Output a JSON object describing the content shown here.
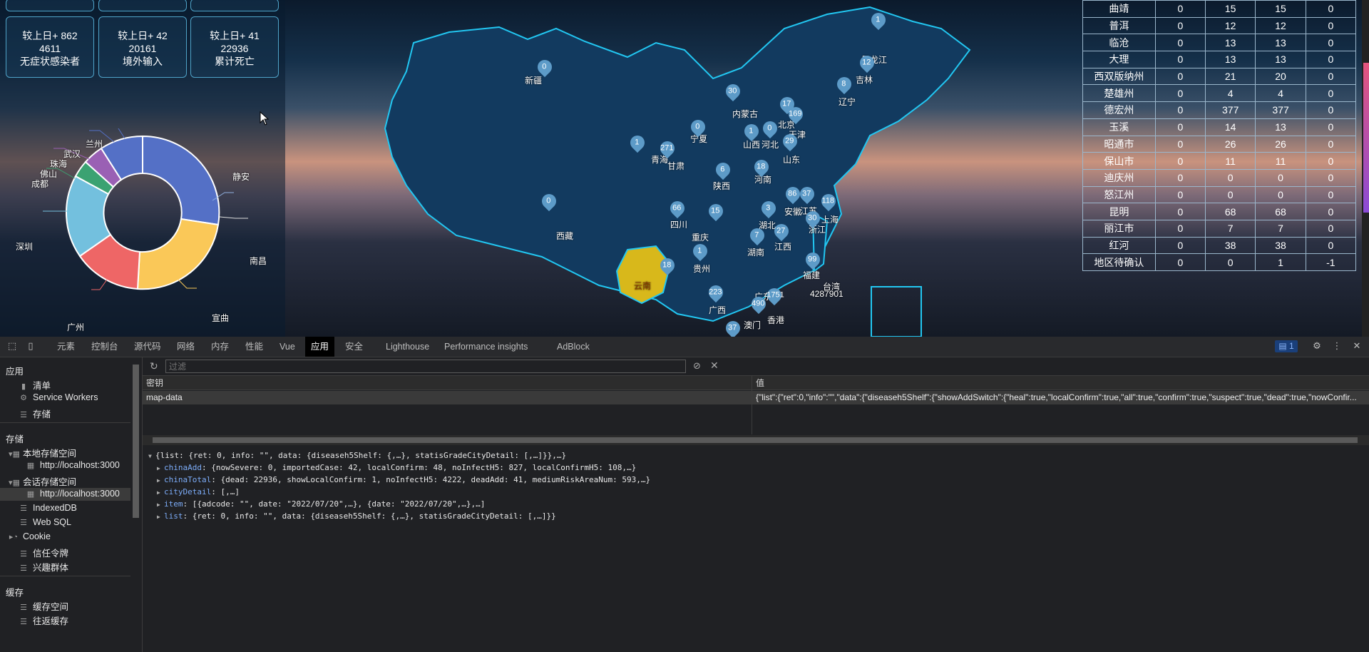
{
  "stats": {
    "cards": [
      {
        "line1": "较上日+ 862",
        "line2": "4611",
        "line3": "无症状感染者"
      },
      {
        "line1": "较上日+ 42",
        "line2": "20161",
        "line3": "境外输入"
      },
      {
        "line1": "较上日+ 41",
        "line2": "22936",
        "line3": "累计死亡"
      }
    ]
  },
  "donut": {
    "labels": [
      "静安",
      "南昌",
      "宣曲",
      "广州",
      "深圳",
      "成都",
      "佛山",
      "珠海",
      "武汉",
      "兰州"
    ],
    "colors": {
      "blue": "#5470c6",
      "yellow": "#fac858",
      "red": "#ee6666",
      "cyan": "#73c0de",
      "green": "#3ba272",
      "purple": "#9a60b4"
    }
  },
  "map": {
    "provinces": [
      "新疆",
      "西藏",
      "青海",
      "甘肃",
      "宁夏",
      "内蒙古",
      "黑龙江",
      "吉林",
      "辽宁",
      "北京",
      "天津",
      "河北",
      "山西",
      "山东",
      "河南",
      "陕西",
      "四川",
      "重庆",
      "湖北",
      "安徽",
      "江苏",
      "上海",
      "浙江",
      "湖南",
      "江西",
      "福建",
      "贵州",
      "云南",
      "广西",
      "广东",
      "台湾",
      "香港",
      "澳门"
    ],
    "pins": [
      "0",
      "0",
      "1",
      "271",
      "0",
      "30",
      "1",
      "12",
      "8",
      "17",
      "169",
      "1",
      "0",
      "29",
      "18",
      "6",
      "66",
      "15",
      "3",
      "86",
      "37",
      "118",
      "30",
      "7",
      "27",
      "99",
      "1",
      "18",
      "223",
      "1751",
      "490",
      "37"
    ],
    "taiwan_value": "4287901",
    "highlight": "云南",
    "highlight_color": "#d8b81b"
  },
  "table": {
    "rows": [
      [
        "曲靖",
        "0",
        "15",
        "15",
        "0"
      ],
      [
        "普洱",
        "0",
        "12",
        "12",
        "0"
      ],
      [
        "临沧",
        "0",
        "13",
        "13",
        "0"
      ],
      [
        "大理",
        "0",
        "13",
        "13",
        "0"
      ],
      [
        "西双版纳州",
        "0",
        "21",
        "20",
        "0"
      ],
      [
        "楚雄州",
        "0",
        "4",
        "4",
        "0"
      ],
      [
        "德宏州",
        "0",
        "377",
        "377",
        "0"
      ],
      [
        "玉溪",
        "0",
        "14",
        "13",
        "0"
      ],
      [
        "昭通市",
        "0",
        "26",
        "26",
        "0"
      ],
      [
        "保山市",
        "0",
        "11",
        "11",
        "0"
      ],
      [
        "迪庆州",
        "0",
        "0",
        "0",
        "0"
      ],
      [
        "怒江州",
        "0",
        "0",
        "0",
        "0"
      ],
      [
        "昆明",
        "0",
        "68",
        "68",
        "0"
      ],
      [
        "丽江市",
        "0",
        "7",
        "7",
        "0"
      ],
      [
        "红河",
        "0",
        "38",
        "38",
        "0"
      ],
      [
        "地区待确认",
        "0",
        "0",
        "1",
        "-1"
      ]
    ]
  },
  "devtools": {
    "tabs": [
      "元素",
      "控制台",
      "源代码",
      "网络",
      "内存",
      "性能",
      "Vue",
      "应用",
      "安全",
      "Lighthouse",
      "Performance insights",
      "AdBlock"
    ],
    "active_tab": "应用",
    "issues_count": "1",
    "sidebar": {
      "app_section": "应用",
      "app_items": [
        "清单",
        "Service Workers",
        "存储"
      ],
      "storage_section": "存储",
      "local_storage": "本地存储空间",
      "local_origin": "http://localhost:3000",
      "session_storage": "会话存储空间",
      "session_origin": "http://localhost:3000",
      "other_items": [
        "IndexedDB",
        "Web SQL",
        "Cookie",
        "信任令牌",
        "兴趣群体"
      ],
      "cache_section": "缓存",
      "cache_items": [
        "缓存空间",
        "往返缓存"
      ]
    },
    "filter_placeholder": "过滤",
    "table_headers": {
      "key": "密钥",
      "value": "值"
    },
    "entry": {
      "key": "map-data",
      "value": "{\"list\":{\"ret\":0,\"info\":\"\",\"data\":{\"diseaseh5Shelf\":{\"showAddSwitch\":{\"heal\":true,\"localConfirm\":true,\"all\":true,\"confirm\":true,\"suspect\":true,\"dead\":true,\"nowConfir..."
    },
    "tree": {
      "root": "{list: {ret: 0, info: \"\", data: {diseaseh5Shelf: {,…}, statisGradeCityDetail: [,…]}},…}",
      "children": [
        {
          "key": "chinaAdd",
          "val": "{nowSevere: 0, importedCase: 42, localConfirm: 48, noInfectH5: 827, localConfirmH5: 108,…}"
        },
        {
          "key": "chinaTotal",
          "val": "{dead: 22936, showLocalConfirm: 1, noInfectH5: 4222, deadAdd: 41, mediumRiskAreaNum: 593,…}"
        },
        {
          "key": "cityDetail",
          "val": "[,…]"
        },
        {
          "key": "item",
          "val": "[{adcode: \"\", date: \"2022/07/20\",…}, {date: \"2022/07/20\",…},…]"
        },
        {
          "key": "list",
          "val": "{ret: 0, info: \"\", data: {diseaseh5Shelf: {,…}, statisGradeCityDetail: [,…]}}"
        }
      ]
    }
  }
}
